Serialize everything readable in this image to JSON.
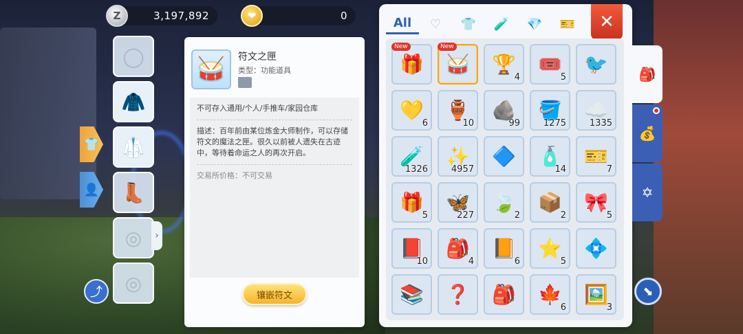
{
  "currency": {
    "zeny_icon": "Z",
    "zeny_amount": "3,197,892",
    "token_amount": "0"
  },
  "equipment": {
    "slots": [
      {
        "icon": "empty-slot-icon",
        "glyph": "◯"
      },
      {
        "icon": "armor-icon",
        "glyph": "🧥"
      },
      {
        "icon": "garment-icon",
        "glyph": "🥼"
      },
      {
        "icon": "empty-slot-icon",
        "glyph": "👢"
      },
      {
        "icon": "empty-slot-icon",
        "glyph": "◎"
      },
      {
        "icon": "empty-slot-icon",
        "glyph": "◎"
      }
    ],
    "tabs": [
      {
        "icon": "shirt-icon",
        "glyph": "👕",
        "active": true
      },
      {
        "icon": "character-icon",
        "glyph": "👤",
        "active": false
      }
    ],
    "share_glyph": "⤴",
    "expand_glyph": "›"
  },
  "detail": {
    "name": "符文之匣",
    "type": "类型：功能道具",
    "icon_glyph": "🥁",
    "storage_note": "不可存入通用/个人/手推车/家园仓库",
    "description": "描述：百年前由某位炼金大师制作，可以存储符文的魔法之匣。很久以前被人遗失在古迹中，等待着命运之人的再次开启。",
    "trade_price": "交易所价格：不可交易",
    "inlay_button": "镶嵌符文"
  },
  "inventory": {
    "tabs": [
      {
        "label": "All",
        "active": true
      },
      {
        "label": "♡",
        "active": false
      },
      {
        "label": "👕",
        "active": false
      },
      {
        "label": "🧪",
        "active": false
      },
      {
        "label": "💎",
        "active": false
      },
      {
        "label": "🎫",
        "active": false
      }
    ],
    "close_label": "✕",
    "items": [
      {
        "glyph": "🎁",
        "qty": "",
        "new": "New",
        "selected": false
      },
      {
        "glyph": "🥁",
        "qty": "",
        "new": "New",
        "selected": true
      },
      {
        "glyph": "🏆",
        "qty": "4",
        "new": "",
        "selected": false
      },
      {
        "glyph": "🎟️",
        "qty": "5",
        "new": "",
        "selected": false
      },
      {
        "glyph": "🐦",
        "qty": "",
        "new": "",
        "selected": false
      },
      {
        "glyph": "💛",
        "qty": "6",
        "new": "",
        "selected": false
      },
      {
        "glyph": "🏺",
        "qty": "10",
        "new": "",
        "selected": false
      },
      {
        "glyph": "🪨",
        "qty": "99",
        "new": "",
        "selected": false
      },
      {
        "glyph": "🪣",
        "qty": "1275",
        "new": "",
        "selected": false
      },
      {
        "glyph": "☁️",
        "qty": "1335",
        "new": "",
        "selected": false
      },
      {
        "glyph": "🧪",
        "qty": "1326",
        "new": "",
        "selected": false
      },
      {
        "glyph": "✨",
        "qty": "4957",
        "new": "",
        "selected": false
      },
      {
        "glyph": "🔷",
        "qty": "",
        "new": "",
        "selected": false
      },
      {
        "glyph": "🧴",
        "qty": "14",
        "new": "",
        "selected": false
      },
      {
        "glyph": "🎫",
        "qty": "7",
        "new": "",
        "selected": false
      },
      {
        "glyph": "🎁",
        "qty": "5",
        "new": "",
        "selected": false
      },
      {
        "glyph": "🦋",
        "qty": "227",
        "new": "",
        "selected": false
      },
      {
        "glyph": "🍃",
        "qty": "2",
        "new": "",
        "selected": false
      },
      {
        "glyph": "📦",
        "qty": "2",
        "new": "",
        "selected": false
      },
      {
        "glyph": "🎀",
        "qty": "5",
        "new": "",
        "selected": false
      },
      {
        "glyph": "📕",
        "qty": "10",
        "new": "",
        "selected": false
      },
      {
        "glyph": "🎒",
        "qty": "4",
        "new": "",
        "selected": false
      },
      {
        "glyph": "📙",
        "qty": "6",
        "new": "",
        "selected": false
      },
      {
        "glyph": "⭐",
        "qty": "5",
        "new": "",
        "selected": false
      },
      {
        "glyph": "💠",
        "qty": "",
        "new": "",
        "selected": false
      },
      {
        "glyph": "📚",
        "qty": "",
        "new": "",
        "selected": false
      },
      {
        "glyph": "❓",
        "qty": "",
        "new": "",
        "selected": false
      },
      {
        "glyph": "🎒",
        "qty": "",
        "new": "",
        "selected": false
      },
      {
        "glyph": "🍁",
        "qty": "6",
        "new": "",
        "selected": false
      },
      {
        "glyph": "🖼️",
        "qty": "3",
        "new": "",
        "selected": false
      }
    ]
  },
  "right_tabs": [
    {
      "icon": "backpack-icon",
      "glyph": "🎒",
      "active": true,
      "dot": false
    },
    {
      "icon": "zeny-bag-icon",
      "glyph": "💰",
      "active": false,
      "dot": true
    },
    {
      "icon": "rune-circle-icon",
      "glyph": "✡",
      "active": false,
      "dot": false
    }
  ],
  "corner_glyph": "⬊"
}
